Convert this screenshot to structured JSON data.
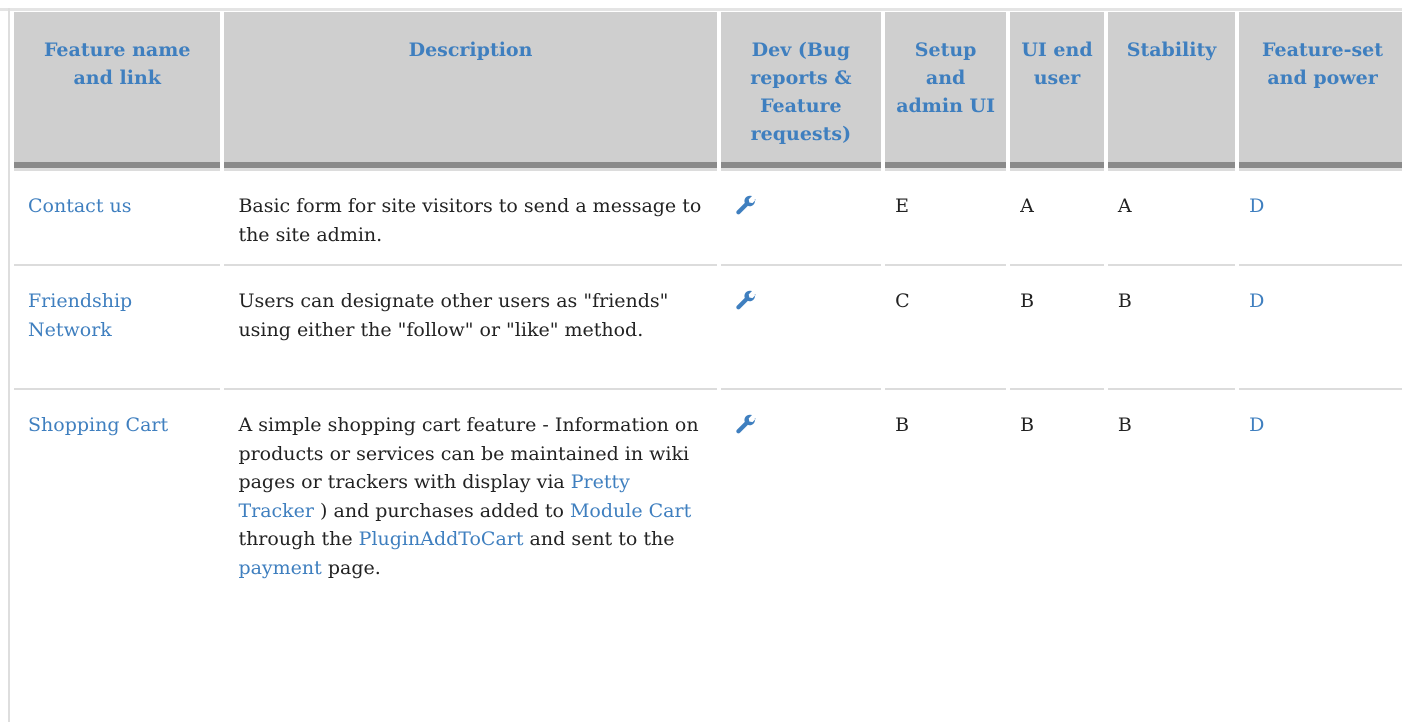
{
  "table": {
    "headers": [
      "Feature name and link",
      "Description",
      "Dev (Bug reports & Feature requests)",
      "Setup and admin UI",
      "UI end user",
      "Stability",
      "Feature-set and power"
    ],
    "rows": [
      {
        "name": "Contact us",
        "desc_text": "Basic form for site visitors to send a message to the site admin.",
        "dev_icon": "wrench-icon",
        "setup": "E",
        "ui": "A",
        "stability": "A",
        "featureset": "D"
      },
      {
        "name": "Friendship Network",
        "desc_text": "Users can designate other users as \"friends\" using either the \"follow\" or \"like\" method.",
        "dev_icon": "wrench-icon",
        "setup": "C",
        "ui": "B",
        "stability": "B",
        "featureset": "D"
      },
      {
        "name": "Shopping Cart",
        "desc_parts": {
          "p1": "A simple shopping cart feature - Information on products or services can be maintained in wiki pages or trackers with display via ",
          "link1": "Pretty Tracker",
          "p2": " ) and purchases added to ",
          "link2": "Module Cart",
          "p3": " through the ",
          "link3": "PluginAddToCart",
          "p4": " and sent to the ",
          "link4": "payment",
          "p5": " page."
        },
        "dev_icon": "wrench-icon",
        "setup": "B",
        "ui": "B",
        "stability": "B",
        "featureset": "D"
      }
    ]
  },
  "colors": {
    "link": "#3f7fbf",
    "header_bg": "#cfcfcf",
    "header_rule": "#8a8a8a"
  }
}
